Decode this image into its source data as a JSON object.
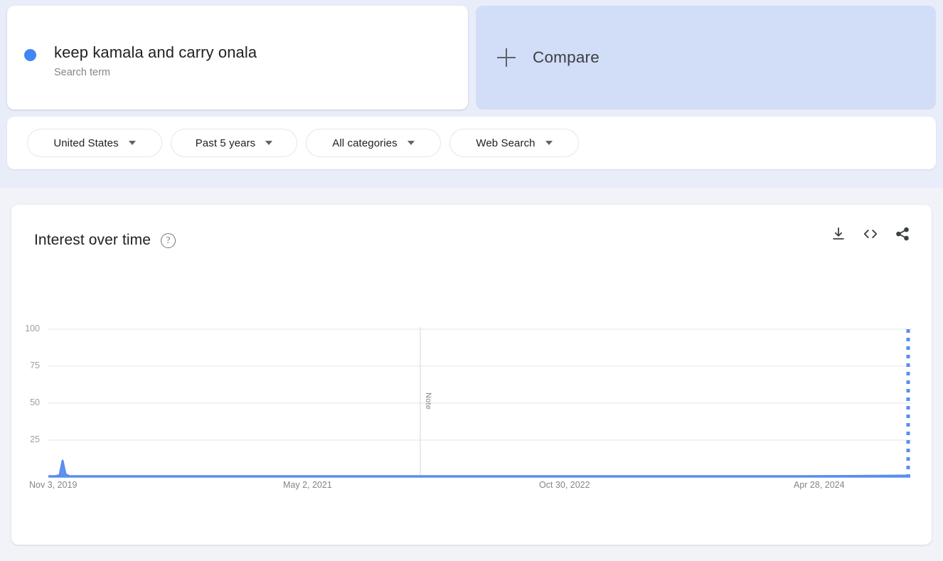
{
  "page": {
    "background": "#f1f3f8",
    "band_background": "#e8edf9",
    "accent": "#4285f4"
  },
  "search_term_card": {
    "term": "keep kamala and carry onala",
    "subtitle": "Search term",
    "dot_color": "#4285f4"
  },
  "compare_card": {
    "label": "Compare",
    "icon": "plus-icon",
    "background": "#d2def8"
  },
  "filters": [
    {
      "label": "United States",
      "icon": "chevron-down-icon",
      "name": "location"
    },
    {
      "label": "Past 5 years",
      "icon": "chevron-down-icon",
      "name": "time-range"
    },
    {
      "label": "All categories",
      "icon": "chevron-down-icon",
      "name": "category"
    },
    {
      "label": "Web Search",
      "icon": "chevron-down-icon",
      "name": "search-type"
    }
  ],
  "chart_panel": {
    "title": "Interest over time",
    "help_icon": "help-circle-icon",
    "help_glyph": "?",
    "actions": [
      {
        "name": "download-csv-button",
        "icon": "download-icon"
      },
      {
        "name": "embed-code-button",
        "icon": "embed-code-icon"
      },
      {
        "name": "share-button",
        "icon": "share-icon"
      }
    ]
  },
  "chart_data": {
    "type": "line",
    "title": "Interest over time",
    "xlabel": "",
    "ylabel": "",
    "ylim": [
      0,
      100
    ],
    "yticks": [
      100,
      75,
      50,
      25
    ],
    "grid": true,
    "legend": false,
    "xticks": [
      "Nov 3, 2019",
      "May 2, 2021",
      "Oct 30, 2022",
      "Apr 28, 2024"
    ],
    "xtick_positions": [
      0.0,
      0.295,
      0.595,
      0.895
    ],
    "series": [
      {
        "name": "keep kamala and carry onala",
        "color": "#5b8def",
        "fill_color": "#5b8def",
        "points": [
          {
            "x": 0.0,
            "y": 0
          },
          {
            "x": 0.007,
            "y": 0
          },
          {
            "x": 0.012,
            "y": 1
          },
          {
            "x": 0.016,
            "y": 12
          },
          {
            "x": 0.02,
            "y": 2
          },
          {
            "x": 0.026,
            "y": 0
          },
          {
            "x": 0.06,
            "y": 0
          },
          {
            "x": 0.2,
            "y": 0
          },
          {
            "x": 0.4,
            "y": 0
          },
          {
            "x": 0.6,
            "y": 0
          },
          {
            "x": 0.8,
            "y": 0
          },
          {
            "x": 0.96,
            "y": 0
          },
          {
            "x": 0.993,
            "y": 0
          },
          {
            "x": 1.0,
            "y": 1
          }
        ]
      }
    ],
    "annotations": [
      {
        "name": "note-marker",
        "label": "Note",
        "x": 0.437,
        "orientation": "vertical",
        "line_color": "#dadce0"
      },
      {
        "name": "partial-data-marker",
        "label": "",
        "x": 0.999,
        "value": 100,
        "style": "dashed",
        "color": "#5b8def"
      }
    ]
  }
}
